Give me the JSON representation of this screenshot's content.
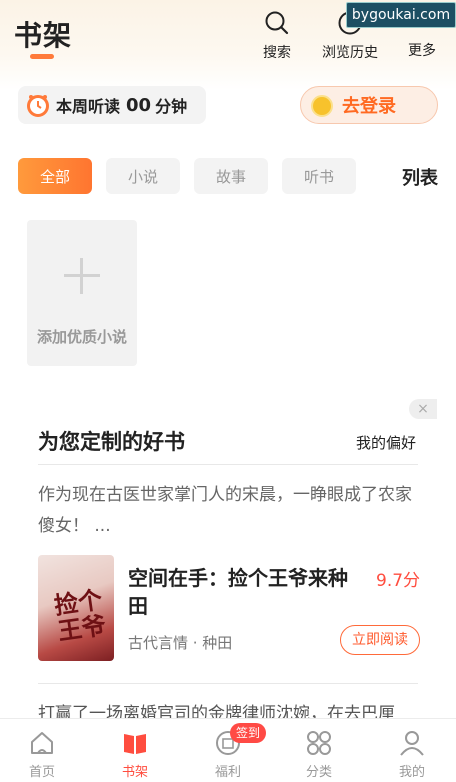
{
  "header": {
    "title": "书架",
    "search_label": "搜索",
    "history_label": "浏览历史",
    "more_label": "更多",
    "watermark": "bygoukai.com"
  },
  "listen": {
    "prefix": "本周听读",
    "minutes": "00",
    "unit": "分钟"
  },
  "login": {
    "label": "去登录"
  },
  "tabs": {
    "all": "全部",
    "novel": "小说",
    "story": "故事",
    "audio": "听书",
    "list_toggle": "列表"
  },
  "shelf": {
    "add_label": "添加优质小说"
  },
  "recommend": {
    "close": "×",
    "title": "为您定制的好书",
    "pref_link": "我的偏好",
    "book1": {
      "desc": "作为现在古医世家掌门人的宋晨，一睁眼成了农家傻女！ ...",
      "cover_text": "捡个王爷",
      "name": "空间在手：捡个王爷来种田",
      "score": "9.7分",
      "meta": "古代言情 · 种田",
      "read_button": "立即阅读"
    },
    "book2": {
      "desc": "打赢了一场离婚官司的金牌律师沈婉，在去巴厘"
    }
  },
  "nav": {
    "home": "首页",
    "shelf": "书架",
    "welfare": "福利",
    "welfare_badge": "签到",
    "category": "分类",
    "mine": "我的"
  },
  "colors": {
    "accent": "#ff7a3a",
    "score": "#ff4d3f",
    "active_nav": "#ff4d3f"
  }
}
